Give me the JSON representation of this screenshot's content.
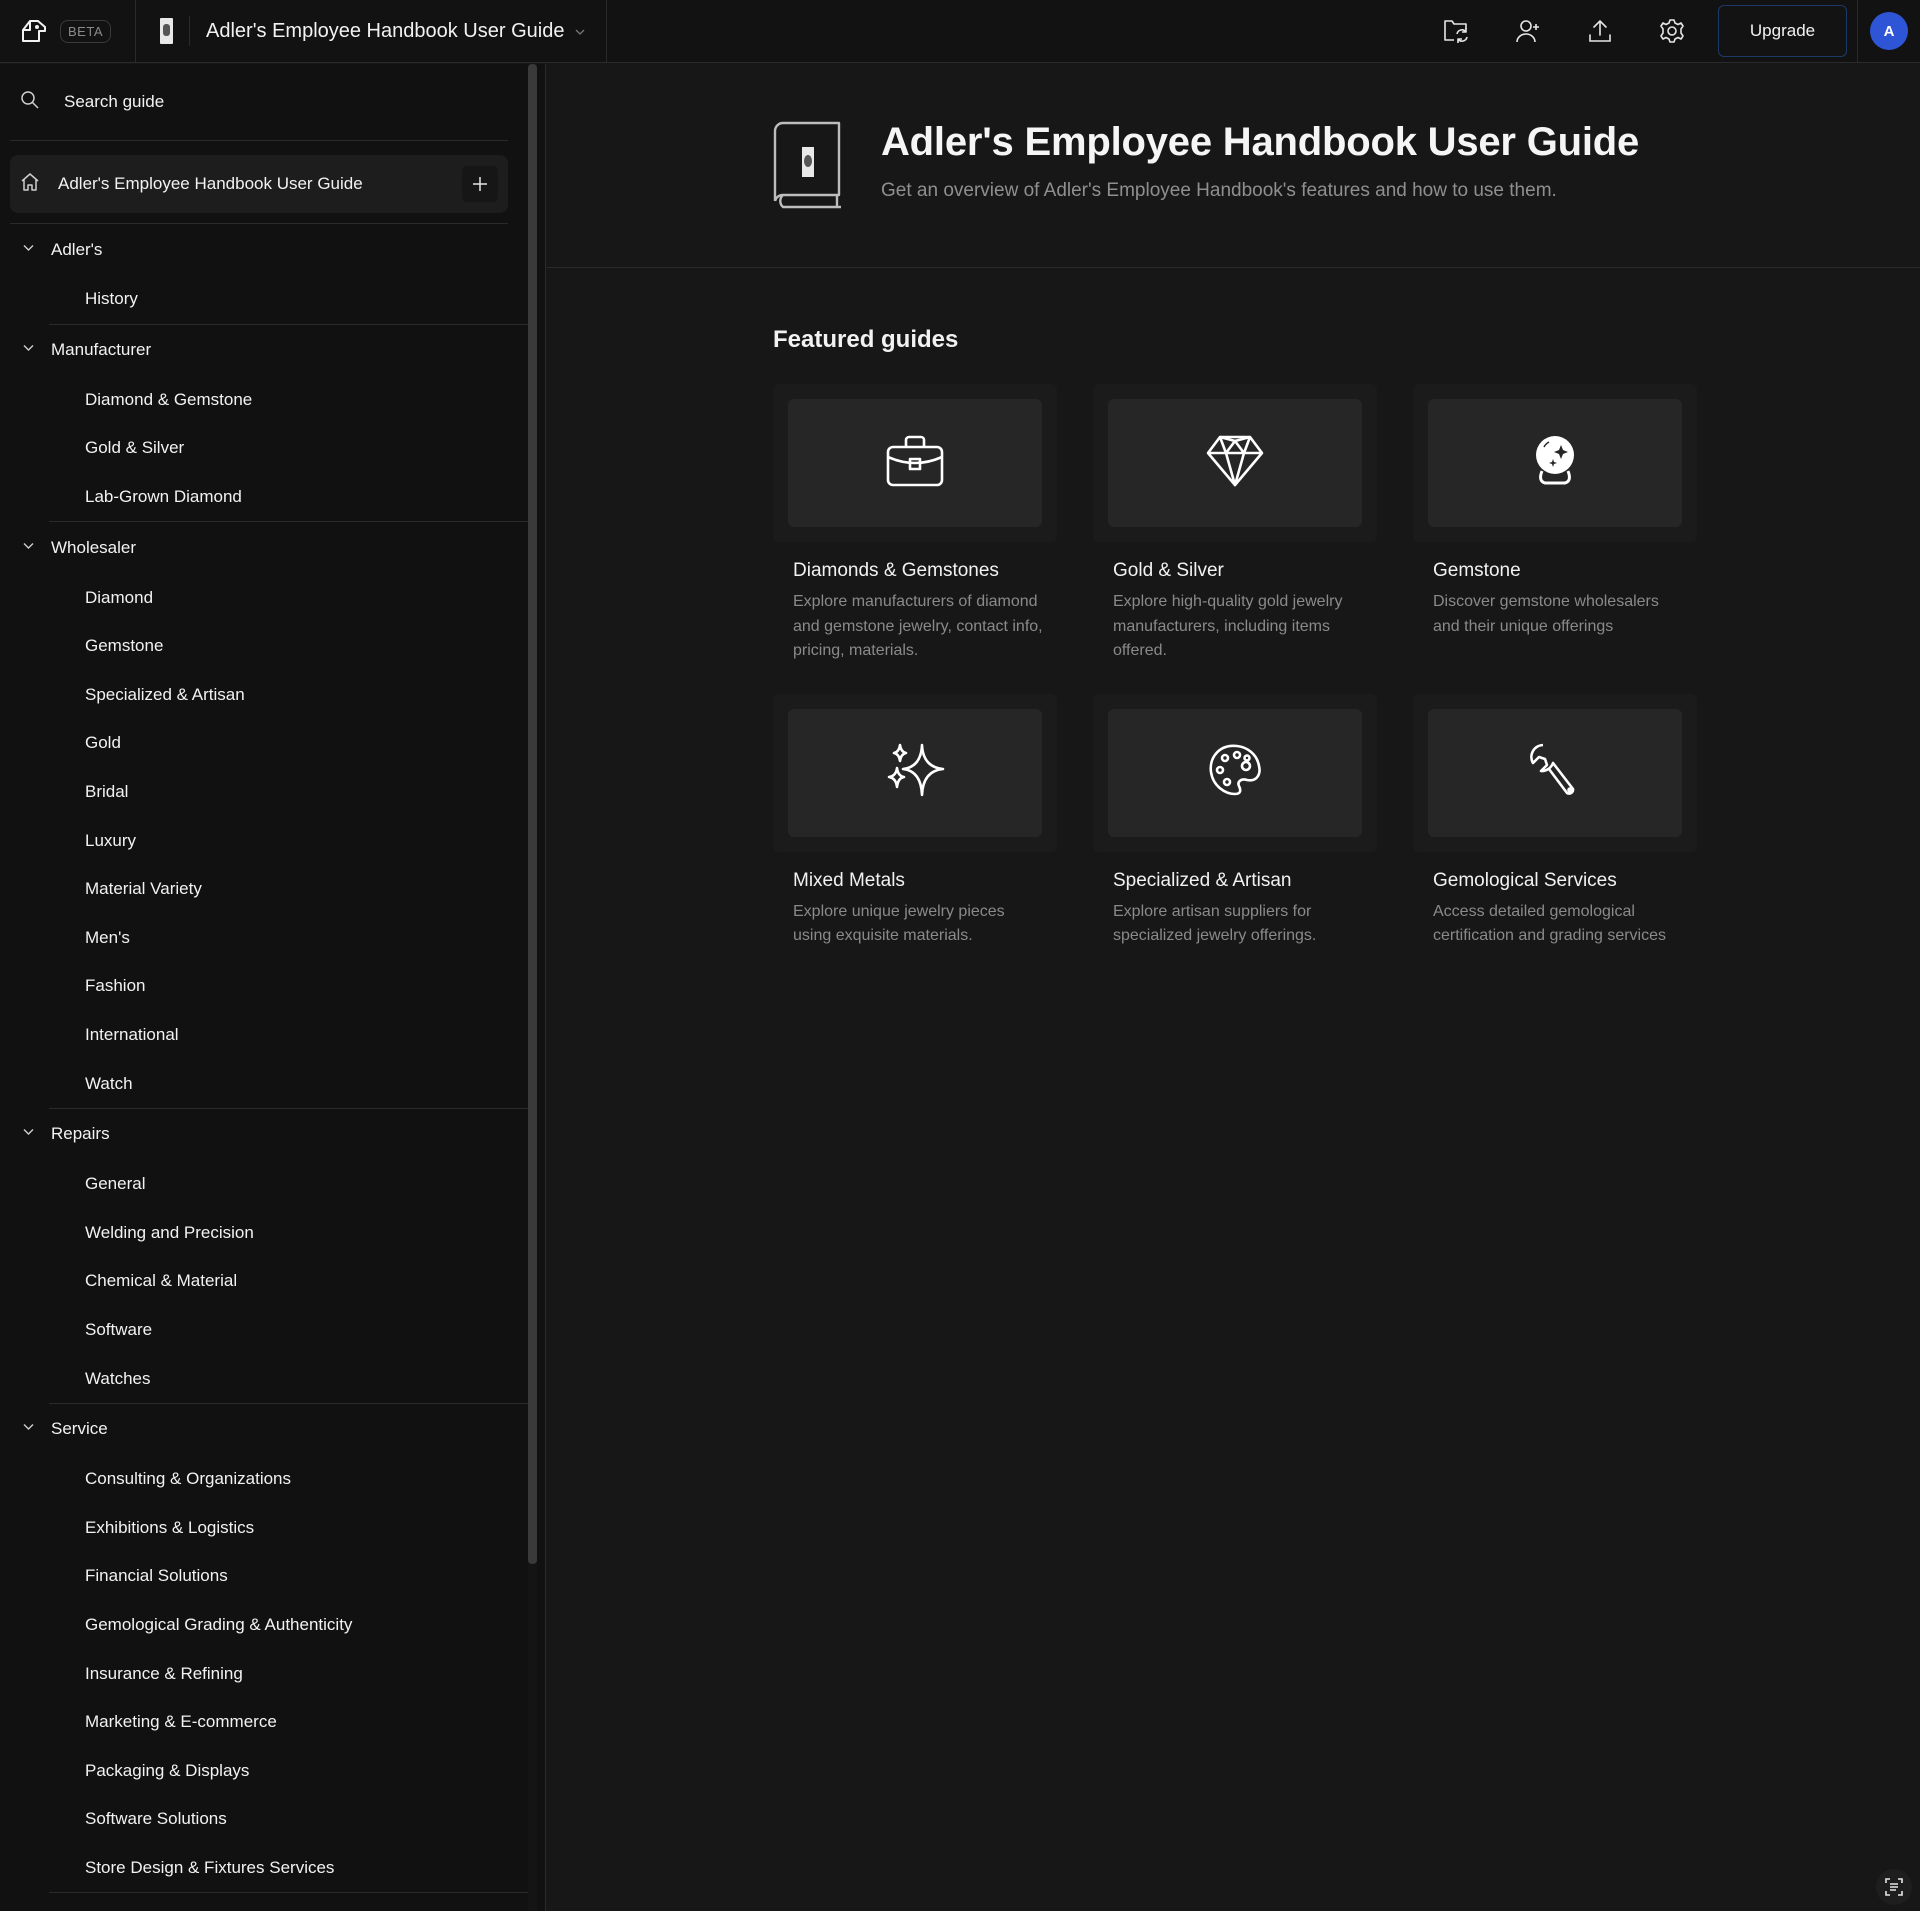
{
  "topbar": {
    "beta_label": "BETA",
    "doc_title": "Adler's Employee Handbook User Guide",
    "upgrade_label": "Upgrade",
    "avatar_initial": "A",
    "icons": [
      "folder-sync-icon",
      "add-user-icon",
      "upload-icon",
      "settings-gear-icon"
    ]
  },
  "sidebar": {
    "search_placeholder": "Search guide",
    "home_label": "Adler's Employee Handbook User Guide",
    "sections": [
      {
        "label": "Adler's",
        "items": [
          "History"
        ]
      },
      {
        "label": "Manufacturer",
        "items": [
          "Diamond & Gemstone",
          "Gold & Silver",
          "Lab-Grown Diamond"
        ]
      },
      {
        "label": "Wholesaler",
        "items": [
          "Diamond",
          "Gemstone",
          "Specialized & Artisan",
          "Gold",
          "Bridal",
          "Luxury",
          "Material Variety",
          "Men's",
          "Fashion",
          "International",
          "Watch"
        ]
      },
      {
        "label": "Repairs",
        "items": [
          "General",
          "Welding and Precision",
          "Chemical & Material",
          "Software",
          "Watches"
        ]
      },
      {
        "label": "Service",
        "items": [
          "Consulting & Organizations",
          "Exhibitions & Logistics",
          "Financial Solutions",
          "Gemological Grading & Authenticity",
          "Insurance & Refining",
          "Marketing & E-commerce",
          "Packaging & Displays",
          "Software Solutions",
          "Store Design & Fixtures Services"
        ]
      }
    ]
  },
  "main": {
    "title": "Adler's Employee Handbook User Guide",
    "subtitle": "Get an overview of Adler's Employee Handbook's features and how to use them.",
    "featured_heading": "Featured guides",
    "cards": [
      {
        "icon": "briefcase-icon",
        "title": "Diamonds & Gemstones",
        "description": "Explore manufacturers of diamond and gemstone jewelry, contact info, pricing, materials."
      },
      {
        "icon": "diamond-icon",
        "title": "Gold & Silver",
        "description": "Explore high-quality gold jewelry manufacturers, including items offered."
      },
      {
        "icon": "crystal-ball-icon",
        "title": "Gemstone",
        "description": "Discover gemstone wholesalers and their unique offerings"
      },
      {
        "icon": "sparkles-icon",
        "title": "Mixed Metals",
        "description": "Explore unique jewelry pieces using exquisite materials."
      },
      {
        "icon": "palette-icon",
        "title": "Specialized & Artisan",
        "description": "Explore artisan suppliers for specialized jewelry offerings."
      },
      {
        "icon": "wrench-icon",
        "title": "Gemological Services",
        "description": "Access detailed gemological certification and grading services"
      }
    ]
  },
  "colors": {
    "background": "#171717",
    "sidebar": "#111111",
    "accent_avatar": "#2e55d6",
    "upgrade_border": "#1d3a66",
    "muted_text": "#8a8a8a"
  }
}
